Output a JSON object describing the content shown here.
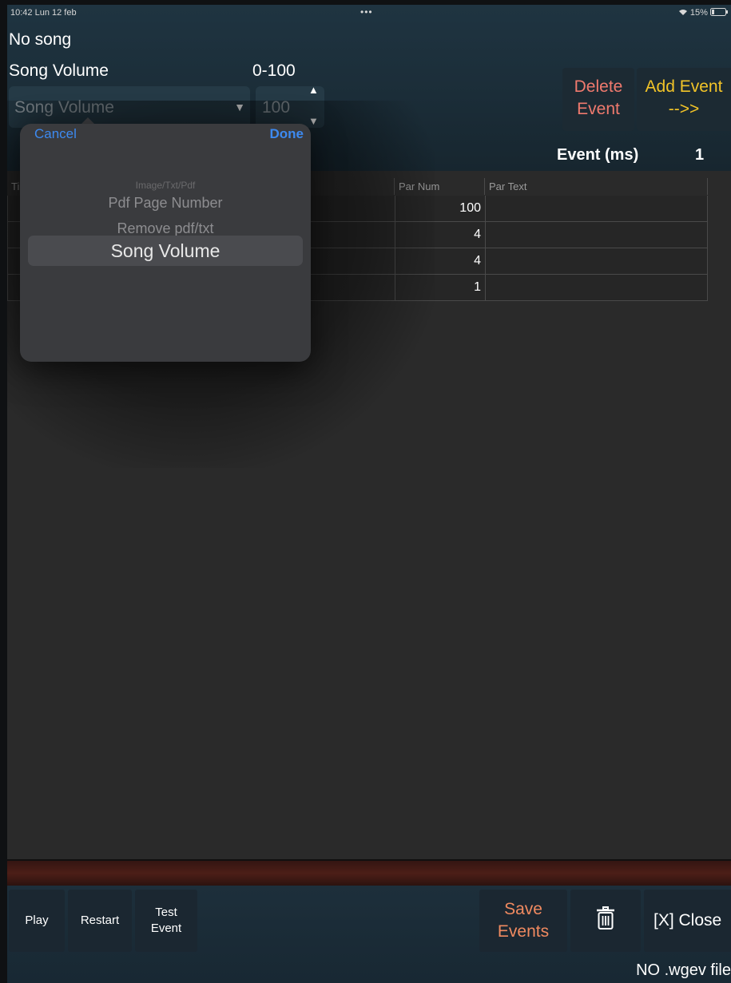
{
  "status_bar": {
    "time": "10:42  Lun 12 feb",
    "dots": "•••",
    "right": "15%"
  },
  "header": {
    "song_title": "No song",
    "param_label": "Song Volume",
    "param_range": "0-100",
    "type_select_value": "Song Volume",
    "value_field": "100",
    "delete_event_line1": "Delete",
    "delete_event_line2": "Event",
    "add_event_line1": "Add Event",
    "add_event_line2": "-->>",
    "event_ms_label": "Event (ms)",
    "event_ms_value": "1"
  },
  "table": {
    "columns": [
      "Ti",
      "Par Num",
      "Par Text"
    ],
    "rows": [
      {
        "par_num": "100",
        "par_text": ""
      },
      {
        "par_num": "4",
        "par_text": ""
      },
      {
        "par_num": "4",
        "par_text": ""
      },
      {
        "par_num": "1",
        "par_text": ""
      }
    ]
  },
  "picker": {
    "cancel": "Cancel",
    "done": "Done",
    "faded_top": "Image/Txt/Pdf",
    "items": [
      "Pdf Page Number",
      "Remove pdf/txt"
    ],
    "selected": "Song Volume"
  },
  "bottom": {
    "play": "Play",
    "restart": "Restart",
    "test_event_line1": "Test",
    "test_event_line2": "Event",
    "save_events_line1": "Save",
    "save_events_line2": "Events",
    "close": "[X] Close",
    "file_status": "NO .wgev file"
  },
  "colors": {
    "delete_accent": "#f07a6e",
    "add_accent": "#f2c428",
    "save_accent": "#f08a60",
    "ios_blue": "#3d8af0"
  }
}
